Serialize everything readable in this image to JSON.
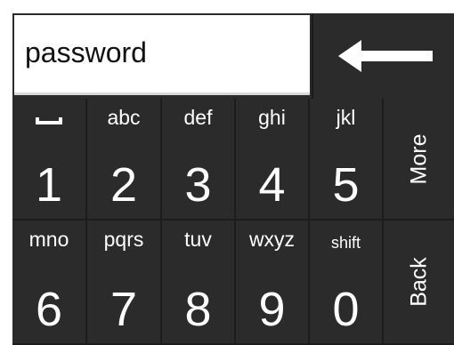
{
  "input": {
    "value": "password"
  },
  "backspace": {
    "icon": "left-arrow-icon"
  },
  "keys": [
    {
      "letters": "",
      "digit": "1",
      "icon": "space-bar-icon"
    },
    {
      "letters": "abc",
      "digit": "2"
    },
    {
      "letters": "def",
      "digit": "3"
    },
    {
      "letters": "ghi",
      "digit": "4"
    },
    {
      "letters": "jkl",
      "digit": "5"
    },
    {
      "letters": "mno",
      "digit": "6"
    },
    {
      "letters": "pqrs",
      "digit": "7"
    },
    {
      "letters": "tuv",
      "digit": "8"
    },
    {
      "letters": "wxyz",
      "digit": "9"
    },
    {
      "letters": "shift",
      "digit": "0"
    }
  ],
  "side": {
    "more_label": "More",
    "back_label": "Back"
  },
  "colors": {
    "key_bg": "#2b2b2b",
    "key_text": "#ffffff",
    "input_bg": "#ffffff"
  }
}
